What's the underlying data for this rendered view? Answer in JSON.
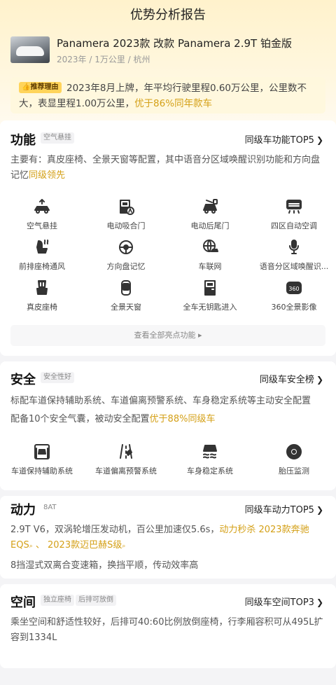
{
  "page_title": "优势分析报告",
  "car": {
    "name": "Panamera 2023款 改款 Panamera 2.9T 铂金版",
    "sub": "2023年 / 1万公里 / 杭州"
  },
  "reason": {
    "badge": "推荐理由",
    "text": "2023年8月上牌，年平均行驶里程0.60万公里，公里数不大，表显里程1.00万公里，",
    "highlight": "优于86%同年款车"
  },
  "features": {
    "title": "功能",
    "tag": "空气悬挂",
    "rank": "同级车功能TOP5",
    "desc": "主要有：真皮座椅、全景天窗等配置，其中语音分区域唤醒识别功能和方向盘记忆",
    "desc_hl": "同级领先",
    "items": [
      {
        "label": "空气悬挂",
        "icon": "air-suspension-icon"
      },
      {
        "label": "电动吸合门",
        "icon": "soft-close-door-icon"
      },
      {
        "label": "电动后尾门",
        "icon": "power-tailgate-icon"
      },
      {
        "label": "四区自动空调",
        "icon": "climate-control-icon"
      },
      {
        "label": "前排座椅通风",
        "icon": "seat-ventilation-icon"
      },
      {
        "label": "方向盘记忆",
        "icon": "steering-memory-icon"
      },
      {
        "label": "车联网",
        "icon": "connected-car-icon"
      },
      {
        "label": "语音分区域唤醒识...",
        "icon": "voice-recognition-icon"
      },
      {
        "label": "真皮座椅",
        "icon": "leather-seat-icon"
      },
      {
        "label": "全景天窗",
        "icon": "panoramic-sunroof-icon"
      },
      {
        "label": "全车无钥匙进入",
        "icon": "keyless-entry-icon"
      },
      {
        "label": "360全景影像",
        "icon": "camera-360-icon"
      }
    ],
    "more": "查看全部亮点功能"
  },
  "safety": {
    "title": "安全",
    "tag": "安全性好",
    "rank": "同级车安全榜",
    "desc1": "标配车道保持辅助系统、车道偏离预警系统、车身稳定系统等主动安全配置",
    "desc2": "配备10个安全气囊，被动安全配置",
    "desc2_hl": "优于88%同级车",
    "items": [
      {
        "label": "车道保持辅助系统",
        "icon": "lane-keep-icon"
      },
      {
        "label": "车道偏离预警系统",
        "icon": "lane-departure-icon"
      },
      {
        "label": "车身稳定系统",
        "icon": "stability-control-icon"
      },
      {
        "label": "胎压监测",
        "icon": "tire-pressure-icon"
      }
    ]
  },
  "power": {
    "title": "动力",
    "tag": "8AT",
    "rank": "同级车动力TOP5",
    "desc_a": "2.9T V6，双涡轮增压发动机，百公里加速仅5.6s，",
    "desc_hl": "动力秒杀 2023款奔驰EQS",
    "desc_mid": " 、 ",
    "desc_hl2": "2023款迈巴赫S级",
    "desc2": "8挡湿式双离合变速箱，换挡平顺，传动效率高"
  },
  "space": {
    "title": "空间",
    "tag1": "独立座椅",
    "tag2": "后排可放倒",
    "rank": "同级车空间TOP3",
    "desc": "乘坐空间和舒适性较好，后排可40:60比例放倒座椅，行李厢容积可从495L扩容到1334L"
  }
}
